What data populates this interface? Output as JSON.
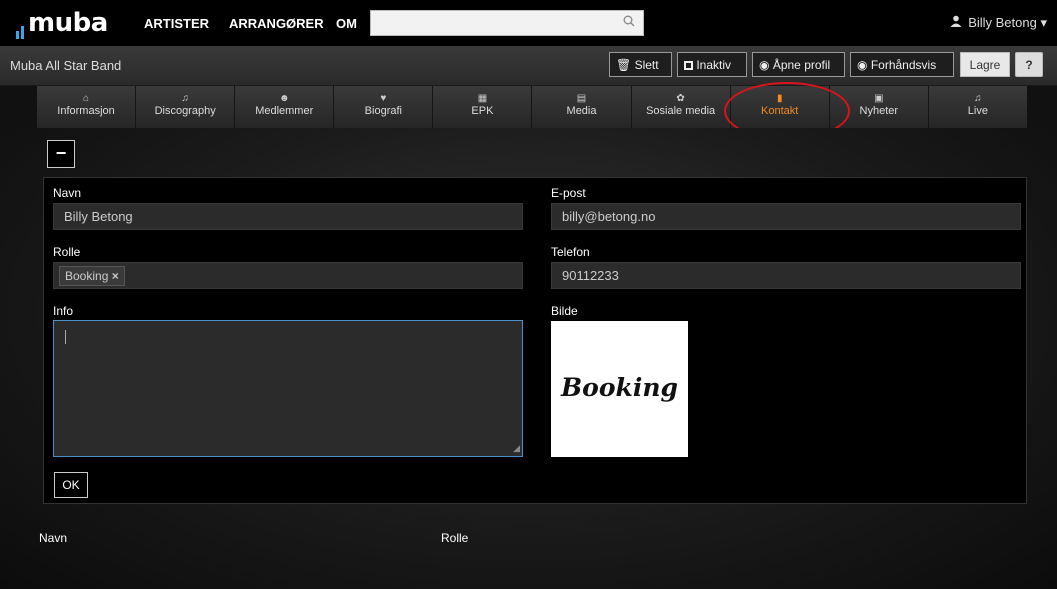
{
  "topbar": {
    "logo": "muba",
    "nav": [
      "ARTISTER",
      "ARRANGØRER",
      "OM"
    ],
    "search_placeholder": "",
    "user_name": "Billy Betong",
    "user_caret": "▾"
  },
  "subbar": {
    "band_name": "Muba All Star Band",
    "buttons": {
      "delete": "Slett",
      "inactive": "Inaktiv",
      "open_profile": "Åpne profil",
      "preview": "Forhåndsvis",
      "save": "Lagre",
      "help": "?"
    }
  },
  "tabs": [
    {
      "label": "Informasjon",
      "icon": "home-icon"
    },
    {
      "label": "Discography",
      "icon": "music-note-icon"
    },
    {
      "label": "Medlemmer",
      "icon": "group-icon"
    },
    {
      "label": "Biografi",
      "icon": "heart-icon"
    },
    {
      "label": "EPK",
      "icon": "calendar-icon"
    },
    {
      "label": "Media",
      "icon": "file-icon"
    },
    {
      "label": "Sosiale media",
      "icon": "gear-icon"
    },
    {
      "label": "Kontakt",
      "icon": "book-icon",
      "active": true
    },
    {
      "label": "Nyheter",
      "icon": "news-icon"
    },
    {
      "label": "Live",
      "icon": "music-note-icon"
    }
  ],
  "form": {
    "name_label": "Navn",
    "name_value": "Billy Betong",
    "email_label": "E-post",
    "email_value": "billy@betong.no",
    "role_label": "Rolle",
    "role_tag": "Booking",
    "role_tag_remove": "×",
    "phone_label": "Telefon",
    "phone_value": "90112233",
    "info_label": "Info",
    "info_value": "",
    "image_label": "Bilde",
    "image_text": "Booking",
    "ok_label": "OK",
    "collapse_symbol": "−"
  },
  "list_header": {
    "name": "Navn",
    "role": "Rolle"
  },
  "colors": {
    "accent": "#f08a24",
    "highlight_circle": "#d8141c",
    "logo_bars": "#3aa6e8"
  }
}
